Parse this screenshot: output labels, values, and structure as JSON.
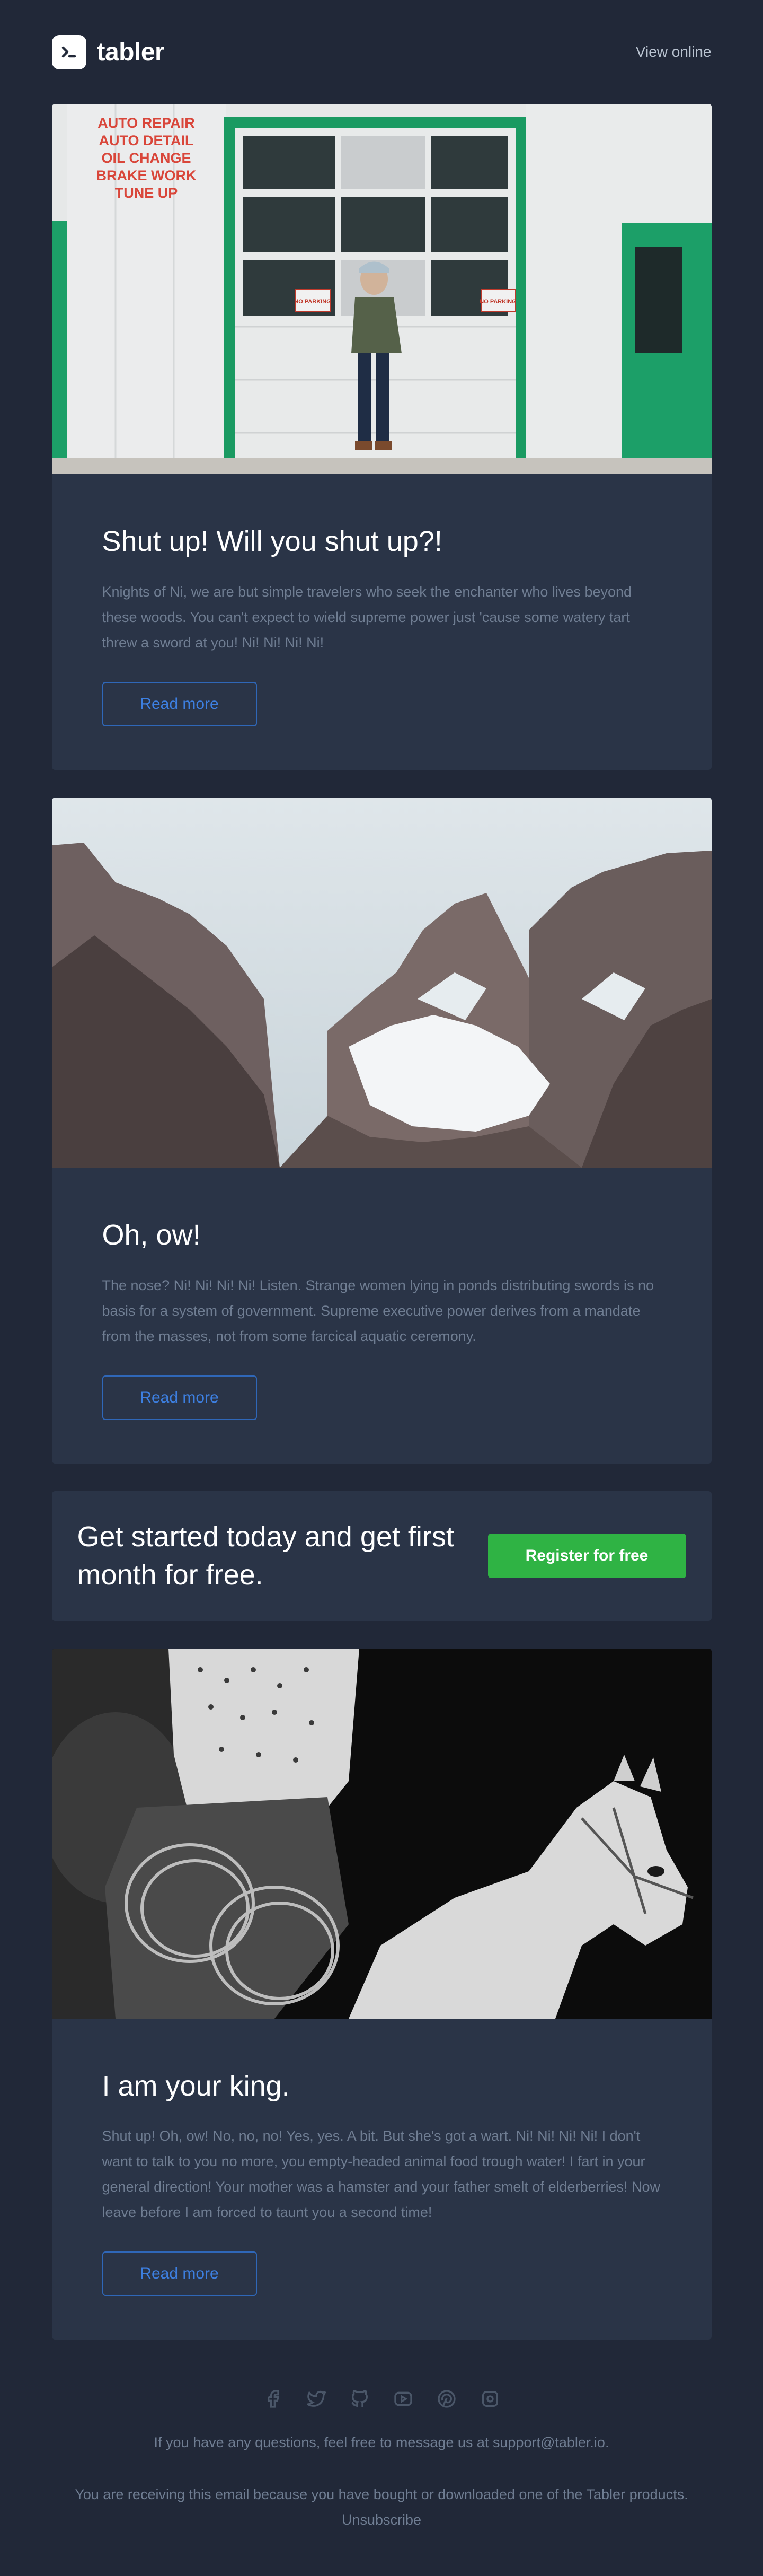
{
  "header": {
    "brand_name": "tabler",
    "view_online": "View online"
  },
  "cards": [
    {
      "image_desc": "garage-photo",
      "garage_sign": [
        "AUTO REPAIR",
        "AUTO DETAIL",
        "OIL CHANGE",
        "BRAKE WORK",
        "TUNE UP"
      ],
      "no_parking": "NO PARKING",
      "title": "Shut up! Will you shut up?!",
      "text": "Knights of Ni, we are but simple travelers who seek the enchanter who lives beyond these woods. You can't expect to wield supreme power just 'cause some watery tart threw a sword at you! Ni! Ni! Ni! Ni!",
      "button": "Read more"
    },
    {
      "image_desc": "mountains-photo",
      "title": "Oh, ow!",
      "text": "The nose? Ni! Ni! Ni! Ni! Listen. Strange women lying in ponds distributing swords is no basis for a system of government. Supreme executive power derives from a mandate from the masses, not from some farcical aquatic ceremony.",
      "button": "Read more"
    },
    {
      "image_desc": "horse-rider-photo",
      "title": "I am your king.",
      "text": "Shut up! Oh, ow! No, no, no! Yes, yes. A bit. But she's got a wart. Ni! Ni! Ni! Ni! I don't want to talk to you no more, you empty-headed animal food trough water! I fart in your general direction! Your mother was a hamster and your father smelt of elderberries! Now leave before I am forced to taunt you a second time!",
      "button": "Read more"
    }
  ],
  "cta": {
    "text": "Get started today and get first month for free.",
    "button": "Register for free"
  },
  "footer": {
    "social_icons": [
      "facebook-icon",
      "twitter-icon",
      "github-icon",
      "youtube-icon",
      "pinterest-icon",
      "instagram-icon"
    ],
    "contact": "If you have any questions, feel free to message us at support@tabler.io.",
    "notice": "You are receiving this email because you have bought or downloaded one of the Tabler products.",
    "unsubscribe": "Unsubscribe"
  },
  "colors": {
    "background": "#212838",
    "card": "#2a3447",
    "accent_blue": "#3d7fe0",
    "accent_green": "#2fb344"
  }
}
